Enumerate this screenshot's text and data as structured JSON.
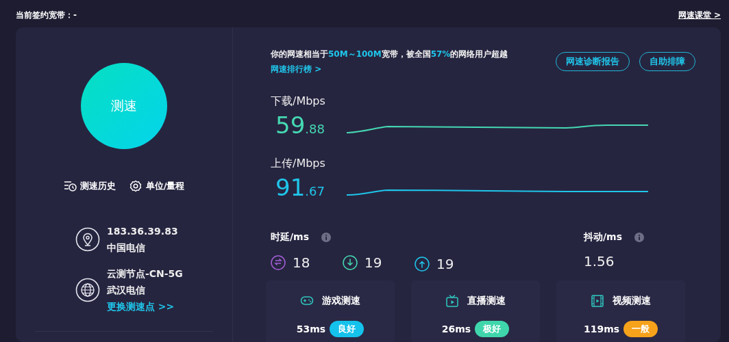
{
  "header": {
    "contract_label": "当前签约宽带：-",
    "course_link": "网速课堂 >"
  },
  "start_button": "测速",
  "tools": [
    {
      "kind": "history",
      "label": "测速历史"
    },
    {
      "kind": "settings",
      "label": "单位/量程"
    }
  ],
  "client": {
    "ip": "183.36.39.83",
    "isp": "中国电信"
  },
  "server": {
    "name": "云测节点-CN-5G",
    "isp": "武汉电信",
    "change_link": "更换测速点 >>"
  },
  "summary": [
    {
      "text": "你的网速相当于",
      "highlight": false
    },
    {
      "text": "50M～100M",
      "highlight": true
    },
    {
      "text": "宽带，被全国",
      "highlight": false
    },
    {
      "text": "57%",
      "highlight": true
    },
    {
      "text": "的网络用户超越",
      "highlight": false
    }
  ],
  "ranking_link": "网速排行榜 >",
  "actions": [
    "网速诊断报告",
    "自助排障"
  ],
  "speeds": [
    {
      "kind": "download",
      "label": "下载/Mbps",
      "integer": "59",
      "decimal": ".88",
      "color": "#45d9b2"
    },
    {
      "kind": "upload",
      "label": "上传/Mbps",
      "integer": "91",
      "decimal": ".67",
      "color": "#1fc6ea"
    }
  ],
  "latency": {
    "label": "时延/ms",
    "values": [
      {
        "kind": "idle",
        "value": "18"
      },
      {
        "kind": "download",
        "value": "19"
      },
      {
        "kind": "upload",
        "value": "19"
      }
    ]
  },
  "jitter": {
    "label": "抖动/ms",
    "value": "1.56"
  },
  "scenes": [
    {
      "kind": "game",
      "title": "游戏测速",
      "latency": "53ms",
      "rating": "良好",
      "color": "#14c2ec"
    },
    {
      "kind": "live",
      "title": "直播测速",
      "latency": "26ms",
      "rating": "极好",
      "color": "#3fd6ac"
    },
    {
      "kind": "video",
      "title": "视频测速",
      "latency": "119ms",
      "rating": "一般",
      "color": "#f7a21b"
    }
  ]
}
